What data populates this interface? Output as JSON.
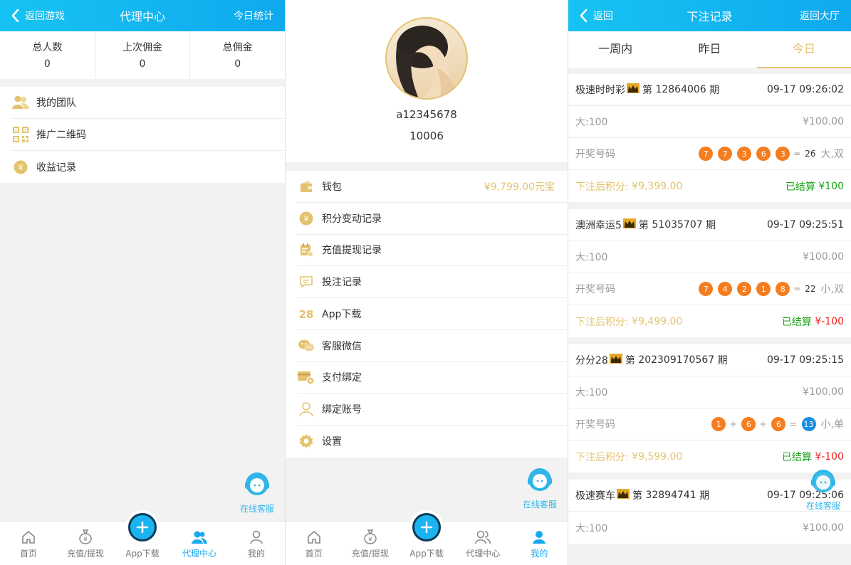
{
  "agent_panel": {
    "header": {
      "back_label": "返回游戏",
      "title": "代理中心",
      "right_label": "今日统计"
    },
    "stats": [
      {
        "label": "总人数",
        "value": "0"
      },
      {
        "label": "上次佣金",
        "value": "0"
      },
      {
        "label": "总佣金",
        "value": "0"
      }
    ],
    "menu": [
      {
        "label": "我的团队",
        "icon": "team-icon"
      },
      {
        "label": "推广二维码",
        "icon": "qrcode-icon"
      },
      {
        "label": "收益记录",
        "icon": "yen-coin-icon"
      }
    ]
  },
  "profile_panel": {
    "username": "a12345678",
    "user_id": "10006",
    "menu": [
      {
        "label": "钱包",
        "value": "¥9,799.00元宝",
        "icon": "wallet-icon"
      },
      {
        "label": "积分变动记录",
        "icon": "yen-coin-icon"
      },
      {
        "label": "充值提现记录",
        "icon": "calendar-icon"
      },
      {
        "label": "投注记录",
        "icon": "message-icon"
      },
      {
        "label": "App下载",
        "icon": "app-28-icon"
      },
      {
        "label": "客服微信",
        "icon": "wechat-icon"
      },
      {
        "label": "支付绑定",
        "icon": "card-gear-icon"
      },
      {
        "label": "绑定账号",
        "icon": "person-outline-icon"
      },
      {
        "label": "设置",
        "icon": "gear-icon"
      }
    ]
  },
  "bets_panel": {
    "header": {
      "back_label": "返回",
      "title": "下注记录",
      "right_label": "返回大厅"
    },
    "tabs": [
      {
        "label": "一周内",
        "active": false
      },
      {
        "label": "昨日",
        "active": false
      },
      {
        "label": "今日",
        "active": true
      }
    ],
    "records": [
      {
        "game": "极速时时彩",
        "period_prefix": "第",
        "period": "12864006",
        "period_suffix": "期",
        "time": "09-17 09:26:02",
        "bet": "大:100",
        "amount": "¥100.00",
        "draw_label": "开奖号码",
        "balls": [
          "7",
          "7",
          "3",
          "6",
          "3"
        ],
        "ops": [
          "",
          "",
          "",
          ""
        ],
        "eq": "=",
        "sum": "26",
        "sum_style": "plain",
        "result": "大,双",
        "after_label": "下注后积分:",
        "after_value": "¥9,399.00",
        "settled_label": "已结算",
        "settled_value": "¥100",
        "settled_color": "green"
      },
      {
        "game": "澳洲幸运5",
        "period_prefix": "第",
        "period": "51035707",
        "period_suffix": "期",
        "time": "09-17 09:25:51",
        "bet": "大:100",
        "amount": "¥100.00",
        "draw_label": "开奖号码",
        "balls": [
          "7",
          "4",
          "2",
          "1",
          "8"
        ],
        "ops": [
          "",
          "",
          "",
          ""
        ],
        "eq": "=",
        "sum": "22",
        "sum_style": "plain",
        "result": "小,双",
        "after_label": "下注后积分:",
        "after_value": "¥9,499.00",
        "settled_label": "已结算",
        "settled_value": "¥-100",
        "settled_color": "red"
      },
      {
        "game": "分分28",
        "period_prefix": "第",
        "period": "202309170567",
        "period_suffix": "期",
        "time": "09-17 09:25:15",
        "bet": "大:100",
        "amount": "¥100.00",
        "draw_label": "开奖号码",
        "balls": [
          "1",
          "6",
          "6"
        ],
        "ops": [
          "+",
          "+"
        ],
        "eq": "=",
        "sum": "13",
        "sum_style": "ball",
        "result": "小,单",
        "after_label": "下注后积分:",
        "after_value": "¥9,599.00",
        "settled_label": "已结算",
        "settled_value": "¥-100",
        "settled_color": "red"
      },
      {
        "game": "极速赛车",
        "period_prefix": "第",
        "period": "32894741",
        "period_suffix": "期",
        "time": "09-17 09:25:06",
        "bet": "大:100",
        "amount": "¥100.00"
      }
    ]
  },
  "support": {
    "label": "在线客服"
  },
  "tabbar": {
    "items": [
      {
        "label": "首页",
        "icon": "home-icon"
      },
      {
        "label": "充值/提现",
        "icon": "money-bag-icon"
      },
      {
        "label": "App下载",
        "icon": "plus-icon"
      },
      {
        "label": "代理中心",
        "icon": "agent-icon"
      },
      {
        "label": "我的",
        "icon": "user-icon"
      }
    ],
    "panel1_active": 3,
    "panel2_active": 4
  },
  "colors": {
    "header": "#16c3f3",
    "accent_gold": "#e4c36f",
    "win_green": "#1aa31a",
    "loss_red": "#ee2222",
    "ball_orange": "#f47d20",
    "ball_blue": "#1a8fe3",
    "tab_active": "#18a8f0"
  }
}
